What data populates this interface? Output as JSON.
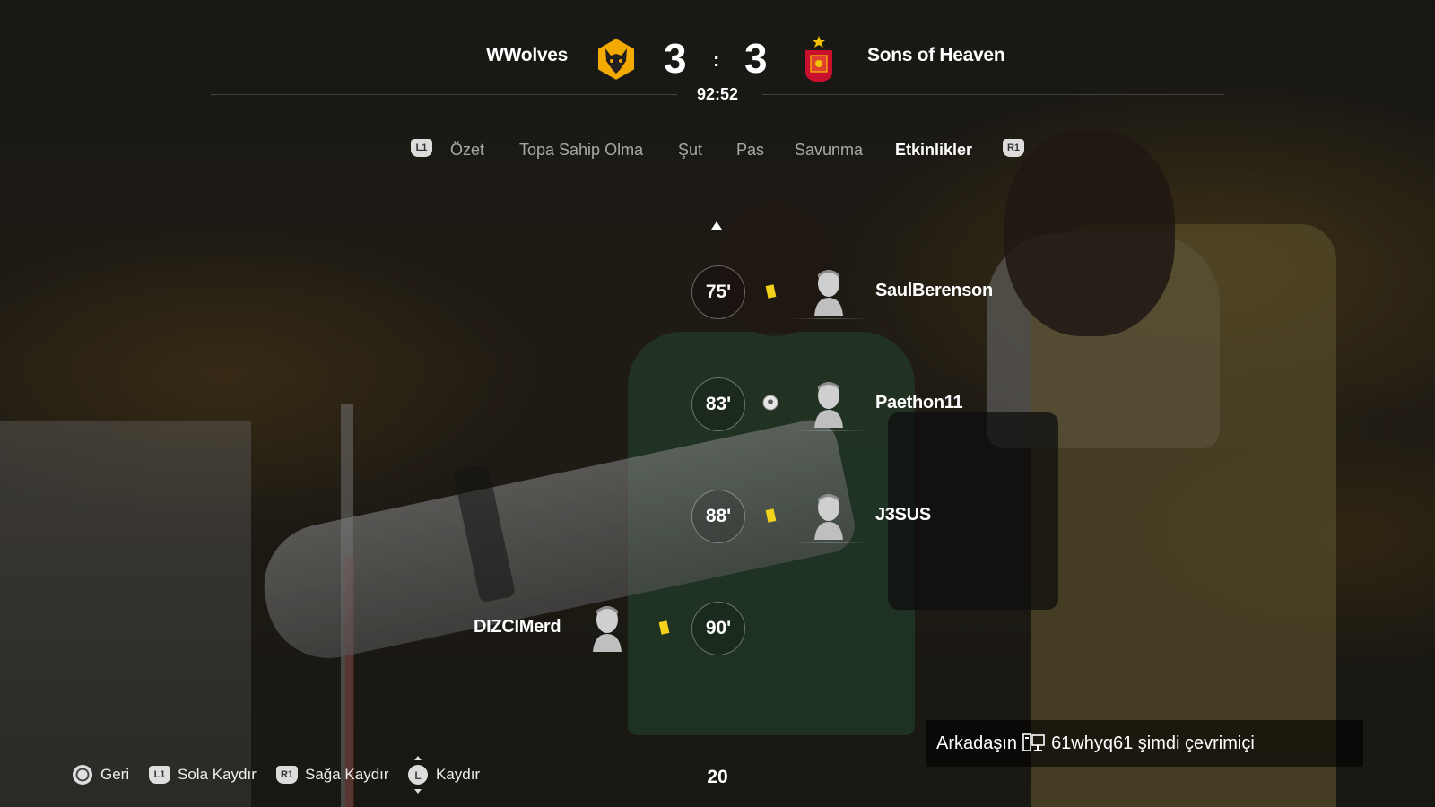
{
  "match": {
    "home_team": "WWolves",
    "away_team": "Sons of Heaven",
    "home_score": "3",
    "away_score": "3",
    "separator": ":",
    "clock": "92:52"
  },
  "tabs": {
    "left_button": "L1",
    "right_button": "R1",
    "items": [
      {
        "label": "Özet",
        "active": false
      },
      {
        "label": "Topa Sahip Olma",
        "active": false
      },
      {
        "label": "Şut",
        "active": false
      },
      {
        "label": "Pas",
        "active": false
      },
      {
        "label": "Savunma",
        "active": false
      },
      {
        "label": "Etkinlikler",
        "active": true
      }
    ]
  },
  "events": [
    {
      "minute": "75'",
      "type": "yellow-card",
      "side": "away",
      "player": "SaulBerenson"
    },
    {
      "minute": "83'",
      "type": "goal",
      "side": "away",
      "player": "Paethon11"
    },
    {
      "minute": "88'",
      "type": "yellow-card",
      "side": "away",
      "player": "J3SUS"
    },
    {
      "minute": "90'",
      "type": "yellow-card",
      "side": "home",
      "player": "DIZCIMerd"
    }
  ],
  "notification": {
    "prefix": "Arkadaşın",
    "icon": "platform-pc-icon",
    "text": "61whyq61 şimdi çevrimiçi"
  },
  "hints": {
    "back": {
      "button": "circle",
      "label": "Geri"
    },
    "scroll_left": {
      "button": "L1",
      "label": "Sola Kaydır"
    },
    "scroll_right": {
      "button": "R1",
      "label": "Sağa Kaydır"
    },
    "scroll": {
      "button": "L",
      "label": "Kaydır"
    }
  },
  "page_count": "20",
  "colors": {
    "yellow_card": "#f3d21b",
    "wolves_gold": "#f2a900",
    "spain_red": "#c8102e"
  }
}
